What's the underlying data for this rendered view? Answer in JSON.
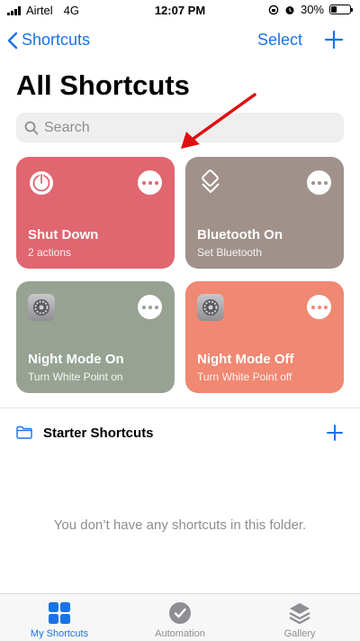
{
  "status_bar": {
    "carrier": "Airtel",
    "network": "4G",
    "time": "12:07 PM",
    "battery": "30%",
    "battery_level": 0.3
  },
  "nav": {
    "back_label": "Shortcuts",
    "select_label": "Select",
    "plus_icon": "plus-icon"
  },
  "page": {
    "title": "All Shortcuts"
  },
  "search": {
    "placeholder": "Search",
    "icon": "search-icon"
  },
  "shortcuts": [
    {
      "title": "Shut Down",
      "subtitle": "2 actions",
      "color": "#e06670",
      "icon": "power-icon"
    },
    {
      "title": "Bluetooth On",
      "subtitle": "Set Bluetooth",
      "color": "#a0918b",
      "icon": "layers-icon"
    },
    {
      "title": "Night Mode On",
      "subtitle": "Turn White Point on",
      "color": "#97a293",
      "icon": "settings-gear-icon"
    },
    {
      "title": "Night Mode Off",
      "subtitle": "Turn White Point off",
      "color": "#f08872",
      "icon": "settings-gear-icon"
    }
  ],
  "annotation": {
    "arrow_color": "#e01010",
    "arrow_icon": "red-arrow"
  },
  "folder": {
    "label": "Starter Shortcuts",
    "icon": "folder-icon"
  },
  "empty_message": "You don’t have any shortcuts in this folder.",
  "tabbar": {
    "tabs": [
      {
        "label": "My Shortcuts",
        "icon": "grid-icon",
        "active": true
      },
      {
        "label": "Automation",
        "icon": "clock-check-icon",
        "active": false
      },
      {
        "label": "Gallery",
        "icon": "layers-icon",
        "active": false
      }
    ]
  },
  "colors": {
    "accent": "#1a73e8",
    "muted": "#8e8e93"
  }
}
